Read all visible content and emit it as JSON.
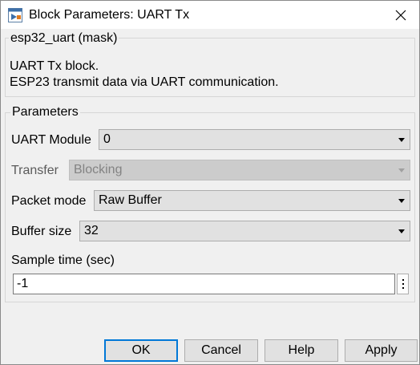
{
  "window": {
    "title": "Block Parameters: UART Tx",
    "close_glyph": "✕",
    "icon": "simulink-block-icon"
  },
  "mask": {
    "group_title": "esp32_uart (mask)",
    "description_line1": "UART Tx block.",
    "description_line2": "ESP23 transmit data via UART communication."
  },
  "parameters": {
    "group_title": "Parameters",
    "uart_module": {
      "label": "UART Module",
      "value": "0"
    },
    "transfer": {
      "label": "Transfer",
      "value": "Blocking",
      "enabled": false
    },
    "packet_mode": {
      "label": "Packet mode",
      "value": "Raw Buffer"
    },
    "buffer_size": {
      "label": "Buffer size",
      "value": "32"
    },
    "sample_time": {
      "label": "Sample time (sec)",
      "value": "-1"
    }
  },
  "buttons": {
    "ok": "OK",
    "cancel": "Cancel",
    "help": "Help",
    "apply": "Apply"
  },
  "colors": {
    "accent": "#0078d7",
    "background": "#f0f0f0",
    "title_background": "#ffffff"
  }
}
